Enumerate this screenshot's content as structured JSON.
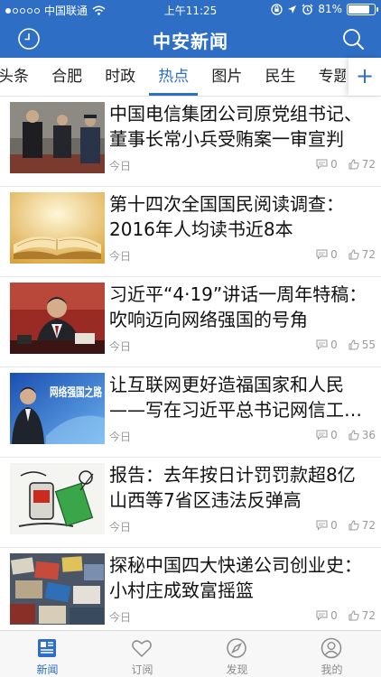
{
  "status": {
    "carrier": "中国联通",
    "time": "上午11:25",
    "battery": "81%",
    "battery_level": 0.81
  },
  "header": {
    "title": "中安新闻"
  },
  "channels": {
    "items": [
      "头条",
      "合肥",
      "时政",
      "热点",
      "图片",
      "民生",
      "专题"
    ],
    "active": "热点"
  },
  "colors": {
    "brand": "#2e6ec4"
  },
  "news": [
    {
      "title": "中国电信集团公司原党组书记、董事长常小兵受贿案一审宣判",
      "date": "今日",
      "comments": "0",
      "likes": "72"
    },
    {
      "title": "第十四次全国国民阅读调查：2016年人均读书近8本",
      "date": "今日",
      "comments": "0",
      "likes": "72"
    },
    {
      "title": "习近平“4·19”讲话一周年特稿：吹响迈向网络强国的号角",
      "date": "今日",
      "comments": "0",
      "likes": "55"
    },
    {
      "title": "让互联网更好造福国家和人民——写在习近平总书记网信工作座谈会讲话发表一周年之际",
      "date": "今日",
      "comments": "0",
      "likes": "36",
      "thumb_text": "网络强国之路"
    },
    {
      "title": "报告：去年按日计罚罚款超8亿 山西等7省区违法反弹高",
      "date": "今日",
      "comments": "0",
      "likes": "72"
    },
    {
      "title": "探秘中国四大快递公司创业史：小村庄成致富摇篮",
      "date": "今日",
      "comments": "0",
      "likes": "72"
    }
  ],
  "tabbar": [
    {
      "label": "新闻",
      "icon": "news-icon"
    },
    {
      "label": "订阅",
      "icon": "heart-icon"
    },
    {
      "label": "发现",
      "icon": "compass-icon"
    },
    {
      "label": "我的",
      "icon": "user-icon"
    }
  ]
}
